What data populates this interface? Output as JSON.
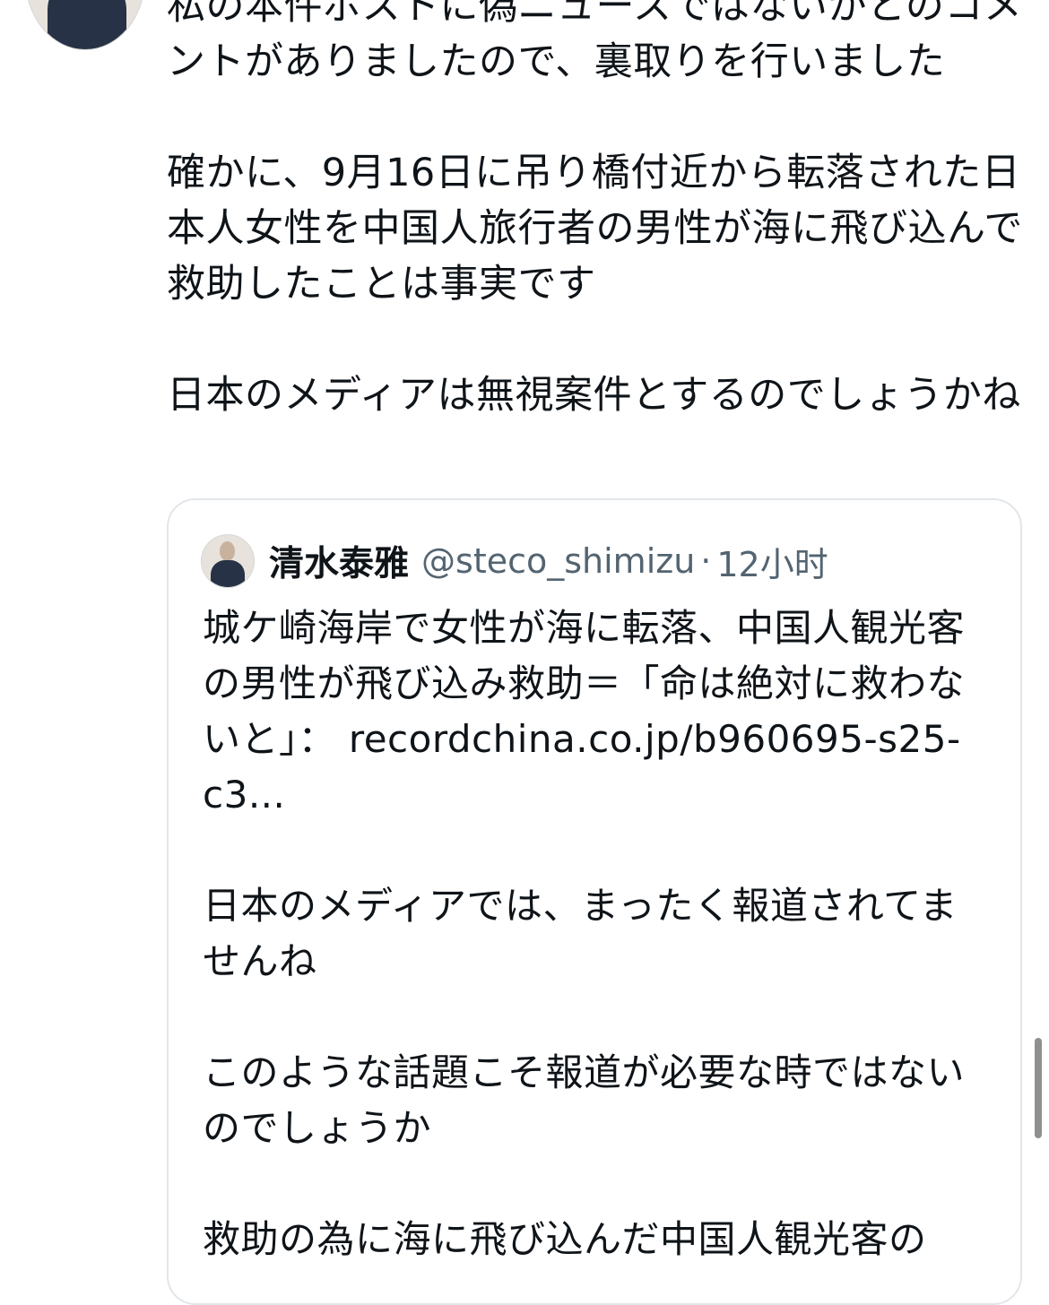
{
  "tweet": {
    "text": "私の本件ポストに偽ニュースではないかとのコメントがありましたので、裏取りを行いました\n\n確かに、9月16日に吊り橋付近から転落された日本人女性を中国人旅行者の男性が海に飛び込んで救助したことは事実です\n\n日本のメディアは無視案件とするのでしょうかね"
  },
  "quote": {
    "name": "清水泰雅",
    "handle": "@steco_shimizu",
    "separator": "·",
    "time": "12小时",
    "text": "城ケ崎海岸で女性が海に転落、中国人観光客の男性が飛び込み救助＝「命は絶対に救わないと」： recordchina.co.jp/b960695-s25-c3...\n\n日本のメディアでは、まったく報道されてませんね\n\nこのような話題こそ報道が必要な時ではないのでしょうか\n\n救助の為に海に飛び込んだ中国人観光客の"
  }
}
